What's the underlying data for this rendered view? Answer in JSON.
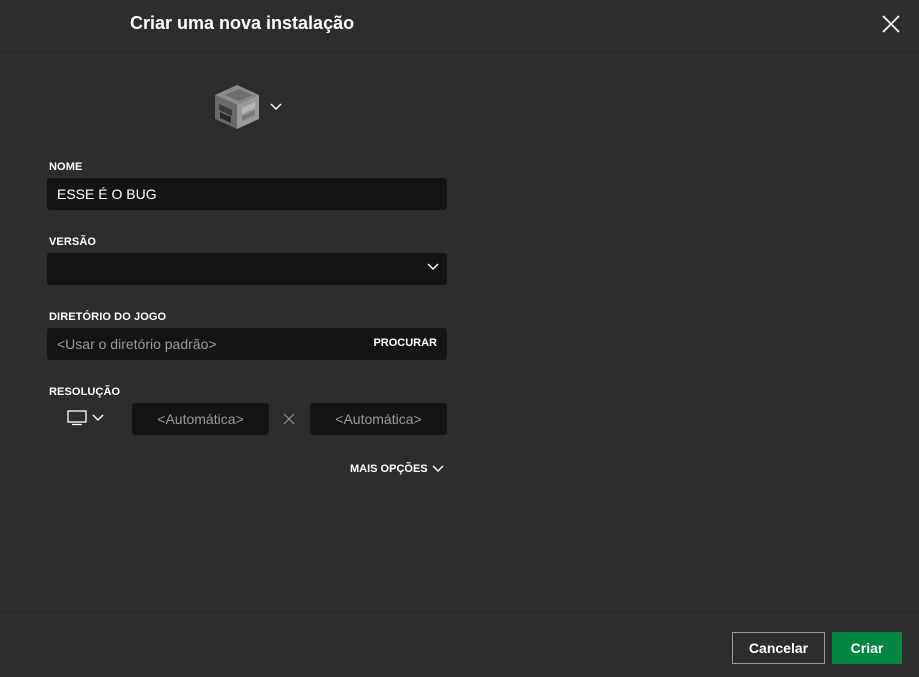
{
  "dialog": {
    "title": "Criar uma nova instalação"
  },
  "form": {
    "name_label": "NOME",
    "name_value": "ESSE É O BUG",
    "version_label": "VERSÃO",
    "version_value": "",
    "directory_label": "DIRETÓRIO DO JOGO",
    "directory_placeholder": "<Usar o diretório padrão>",
    "browse_label": "PROCURAR",
    "resolution_label": "RESOLUÇÃO",
    "width_placeholder": "<Automática>",
    "height_placeholder": "<Automática>",
    "more_options_label": "MAIS OPÇÕES"
  },
  "footer": {
    "cancel_label": "Cancelar",
    "create_label": "Criar"
  },
  "colors": {
    "background": "#2d2d2d",
    "field_background": "#141414",
    "create_button": "#008542"
  },
  "icons": [
    "close-icon",
    "furnace-icon",
    "chevron-down-icon",
    "monitor-icon",
    "times-icon"
  ]
}
